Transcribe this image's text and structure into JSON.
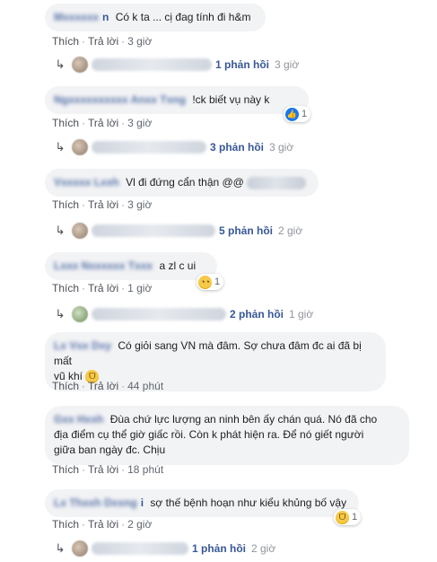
{
  "labels": {
    "like": "Thích",
    "reply": "Trả lời",
    "sep": "·"
  },
  "comments": [
    {
      "author_tail": "n",
      "text": "Có k ta ... cị đag tính đi h&m",
      "time": "3 giờ",
      "reply_summary": {
        "count_text": "1 phản hồi",
        "time": "3 giờ"
      }
    },
    {
      "author_tail": "",
      "text": "!ck biết vụ này k",
      "time": "3 giờ",
      "reaction": {
        "icon": "like-icon",
        "count": "1"
      },
      "reply_summary": {
        "count_text": "3 phản hồi",
        "time": "3 giờ"
      }
    },
    {
      "author_tail": "",
      "text": "Vl đi đứng cẩn thận @@",
      "time": "3 giờ",
      "reply_summary": {
        "count_text": "5 phản hồi",
        "time": "2 giờ"
      }
    },
    {
      "author_tail": "",
      "text": "a zl c ui",
      "time": "1 giờ",
      "reaction": {
        "icon": "sad-emoji-icon",
        "count": "1"
      },
      "reply_summary": {
        "count_text": "2 phản hồi",
        "time": "1 giờ"
      }
    },
    {
      "author_tail": "",
      "text_lines": [
        "Có giỏi sang VN mà đâm. Sợ chưa đâm đc ai đã bị mất",
        "vũ khí"
      ],
      "time": "44 phút",
      "inline_emoji": "laughing-emoji-icon"
    },
    {
      "author_tail": "",
      "text_lines": [
        "Đùa chứ lực lượng an ninh bên ấy chán quá. Nó đã cho",
        "địa điểm cụ thể giờ giấc rồi. Còn k phát hiện ra. Để nó giết người",
        "giữa ban ngày đc. Chịu"
      ],
      "time": "18 phút"
    },
    {
      "author_tail": "i",
      "text": "sợ thế bệnh hoạn như kiểu khủng bố vậy",
      "time": "2 giờ",
      "reaction": {
        "icon": "laughing-emoji-icon",
        "count": "1"
      },
      "reply_summary": {
        "count_text": "1 phản hồi",
        "time": "2 giờ"
      }
    }
  ]
}
